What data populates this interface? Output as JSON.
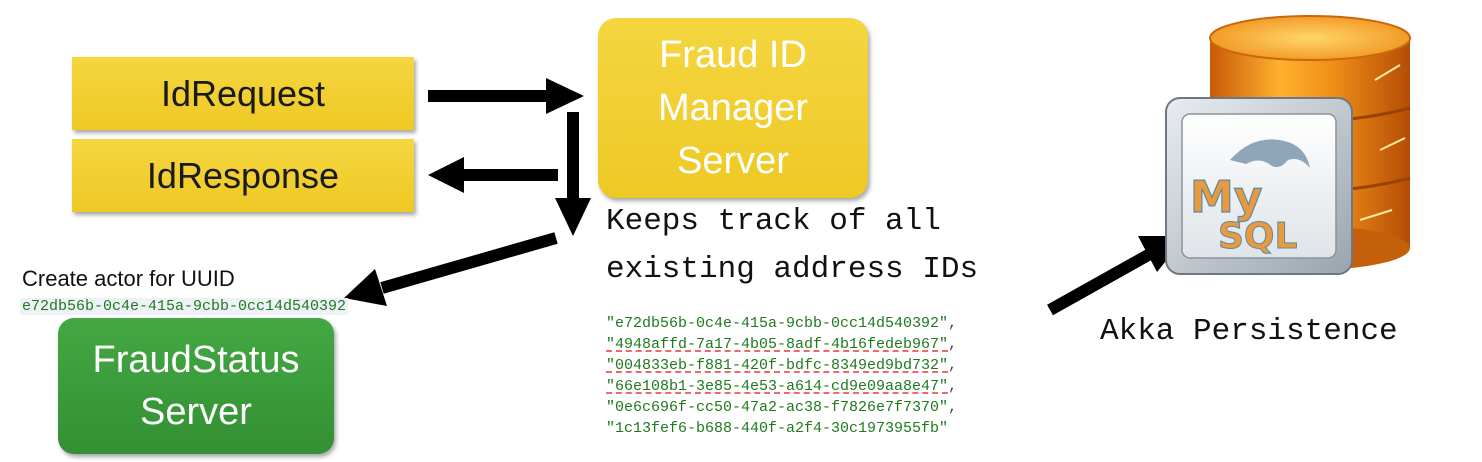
{
  "boxes": {
    "id_request": "IdRequest",
    "id_response": "IdResponse",
    "manager": [
      "Fraud ID",
      "Manager",
      "Server"
    ],
    "fraud_status": [
      "FraudStatus",
      "Server"
    ]
  },
  "notes": {
    "keeps_track": [
      "Keeps track of all",
      "existing address IDs"
    ],
    "create_actor": "Create actor for UUID",
    "create_uuid": "e72db56b-0c4e-415a-9cbb-0cc14d540392",
    "akka": "Akka Persistence"
  },
  "uuid_list": [
    {
      "text": "\"e72db56b-0c4e-415a-9cbb-0cc14d540392\"",
      "sep": ",",
      "underlined": false
    },
    {
      "text": "\"4948affd-7a17-4b05-8adf-4b16fedeb967\"",
      "sep": ",",
      "underlined": true
    },
    {
      "text": "\"004833eb-f881-420f-bdfc-8349ed9bd732\"",
      "sep": ",",
      "underlined": true
    },
    {
      "text": "\"66e108b1-3e85-4e53-a614-cd9e09aa8e47\"",
      "sep": ",",
      "underlined": true
    },
    {
      "text": "\"0e6c696f-cc50-47a2-ac38-f7826e7f7370\"",
      "sep": ",",
      "underlined": false
    },
    {
      "text": "\"1c13fef6-b688-440f-a2f4-30c1973955fb\"",
      "sep": "",
      "underlined": false
    }
  ],
  "logo": {
    "line1": "My",
    "line2": "SQL"
  },
  "colors": {
    "yellow": "#f1ce2f",
    "green": "#3a9c3a",
    "code_green": "#1f7a1f",
    "db_orange": "#f08a1c"
  }
}
